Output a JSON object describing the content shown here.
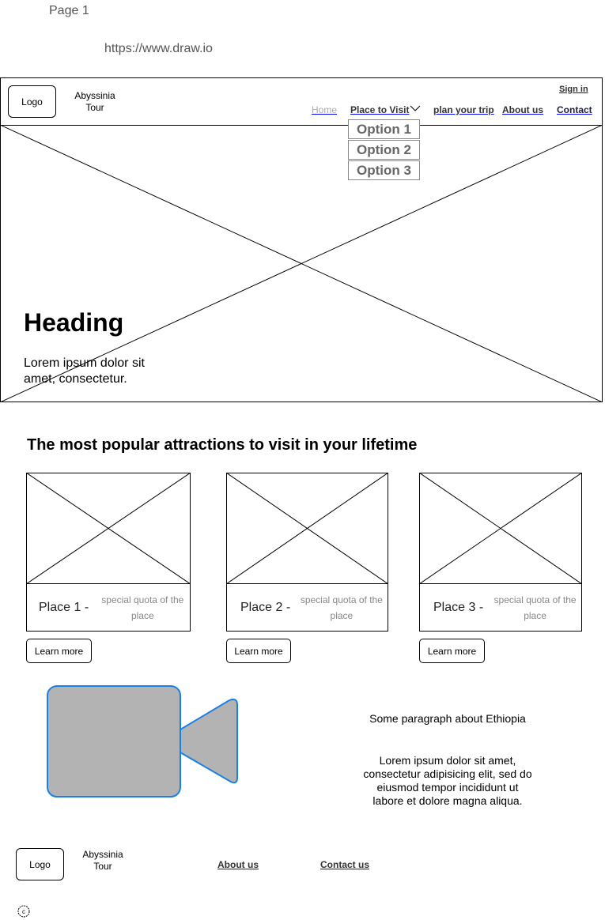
{
  "page": {
    "label": "Page 1",
    "url": "https://www.draw.io"
  },
  "header": {
    "logo": "Logo",
    "brand": [
      "Abyssinia",
      "Tour"
    ],
    "sign_in": "Sign in",
    "nav": {
      "home": "Home",
      "places": "Place to Visit",
      "plan": "plan your trip",
      "about": "About us",
      "contact": "Contact"
    },
    "dropdown": [
      "Option 1",
      "Option 2",
      "Option 3"
    ]
  },
  "hero": {
    "heading": "Heading",
    "text": [
      "Lorem ipsum dolor sit",
      "amet, consectetur."
    ]
  },
  "attractions": {
    "title": "The most popular attractions to visit in your lifetime",
    "cards": [
      {
        "place": "Place 1 -",
        "quota": "special quota of the place",
        "button": "Learn more"
      },
      {
        "place": "Place 2 -",
        "quota": "special quota of the place",
        "button": "Learn more"
      },
      {
        "place": "Place 3 -",
        "quota": "special quota of the place",
        "button": "Learn more"
      }
    ]
  },
  "video": {
    "icon": "video-camera-icon",
    "fill": "#b3b3b3",
    "stroke": "#1a7fe6"
  },
  "about": {
    "title": "Some paragraph about Ethiopia",
    "text": [
      "Lorem ipsum dolor sit amet,",
      "consectetur adipisicing elit, sed do",
      "eiusmod tempor incididunt ut",
      "labore et dolore magna aliqua."
    ]
  },
  "footer": {
    "logo": "Logo",
    "brand": [
      "Abyssinia",
      "Tour"
    ],
    "about": "About us",
    "contact": "Contact us",
    "copyright_icon": "copyright-icon"
  }
}
